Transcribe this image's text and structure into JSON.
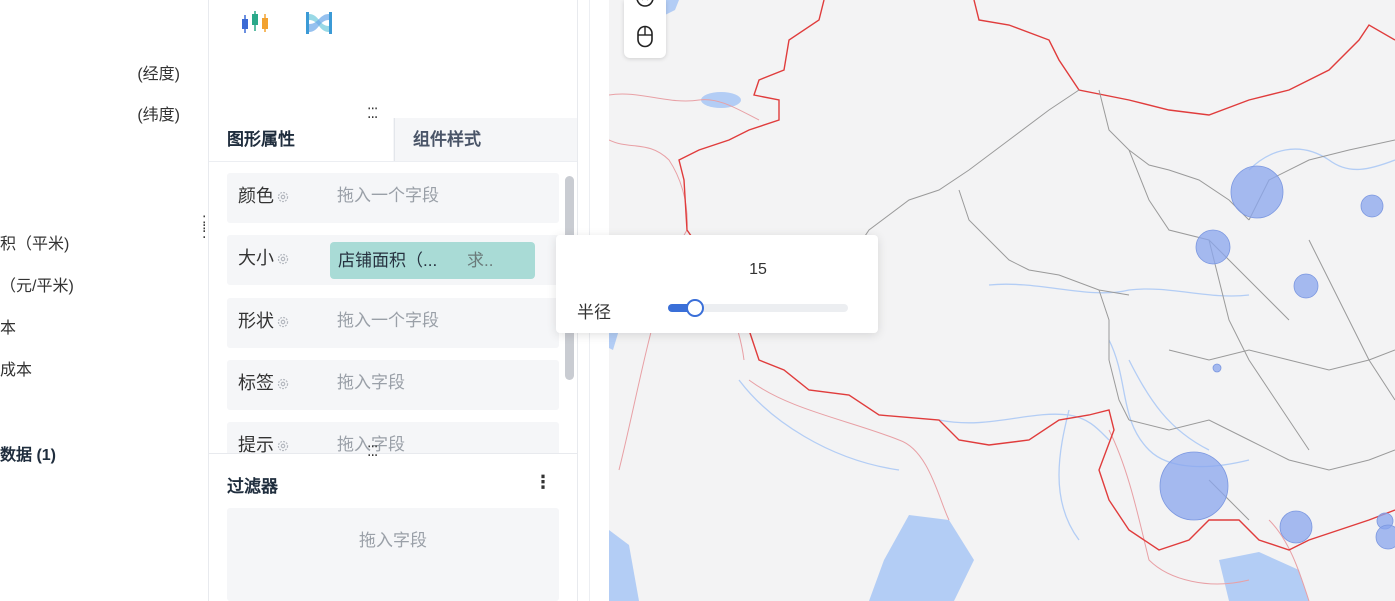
{
  "fields": {
    "longitude_suffix": "(经度)",
    "latitude_suffix": "(纬度)",
    "area_field": "积（平米)",
    "rent_field": "（元/平米)",
    "cost_field": "本",
    "other_cost_field": "成本",
    "data_section": "数据 (1)"
  },
  "tabs": {
    "shape": "图形属性",
    "style": "组件样式"
  },
  "props": {
    "color_label": "颜色",
    "size_label": "大小",
    "shape_label": "形状",
    "tag_label": "标签",
    "tooltip_label": "提示",
    "drop_one_field": "拖入一个字段",
    "drop_field": "拖入字段",
    "size_pill_text": "店铺面积（...",
    "size_pill_agg": "求.."
  },
  "filter": {
    "title": "过滤器",
    "more": "⋮",
    "placeholder": "拖入字段"
  },
  "radius": {
    "label": "半径",
    "value": "15",
    "slider_fraction": 0.15
  },
  "map": {
    "land_color": "#f3f3f4",
    "water_color": "#b3cdf5",
    "bubble_color": "#8aa6ee",
    "border_color_national": "#e03c3c",
    "border_color_province": "#9a9a9a"
  },
  "icons": {
    "chart_candlestick": "candlestick-chart-icon",
    "chart_sankey": "sankey-chart-icon",
    "map_tool_top": "rotate-icon",
    "map_tool_mouse": "mouse-icon",
    "settings": "gear-icon"
  }
}
